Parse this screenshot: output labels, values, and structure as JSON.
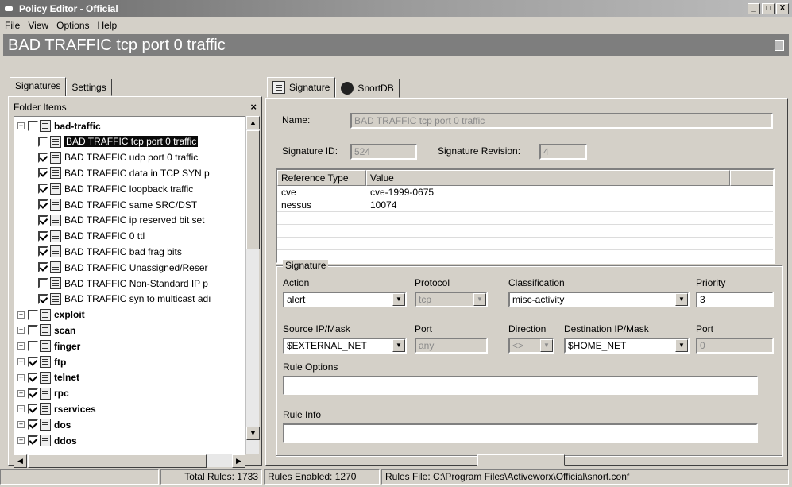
{
  "window": {
    "title": "Policy Editor - Official",
    "buttons": [
      "_",
      "□",
      "X"
    ]
  },
  "menu": [
    "File",
    "View",
    "Options",
    "Help"
  ],
  "policy_title": "BAD TRAFFIC tcp port 0 traffic",
  "left": {
    "tabs": [
      "Signatures",
      "Settings"
    ],
    "folder_header": "Folder Items",
    "close_glyph": "×",
    "tree": [
      {
        "type": "folder",
        "label": "bad-traffic",
        "checked": false,
        "expander": "−"
      },
      {
        "type": "rule",
        "label": "BAD TRAFFIC tcp port 0 traffic",
        "checked": false,
        "selected": true
      },
      {
        "type": "rule",
        "label": "BAD TRAFFIC udp port 0 traffic",
        "checked": true
      },
      {
        "type": "rule",
        "label": "BAD TRAFFIC data in TCP SYN p",
        "checked": true
      },
      {
        "type": "rule",
        "label": "BAD TRAFFIC loopback traffic",
        "checked": true
      },
      {
        "type": "rule",
        "label": "BAD TRAFFIC same SRC/DST",
        "checked": true
      },
      {
        "type": "rule",
        "label": "BAD TRAFFIC ip reserved bit set",
        "checked": true
      },
      {
        "type": "rule",
        "label": "BAD TRAFFIC 0 ttl",
        "checked": true
      },
      {
        "type": "rule",
        "label": "BAD TRAFFIC bad frag bits",
        "checked": true
      },
      {
        "type": "rule",
        "label": "BAD TRAFFIC Unassigned/Reser",
        "checked": true
      },
      {
        "type": "rule",
        "label": "BAD TRAFFIC Non-Standard IP p",
        "checked": false
      },
      {
        "type": "rule",
        "label": "BAD TRAFFIC syn to multicast adı",
        "checked": true
      },
      {
        "type": "folder",
        "label": "exploit",
        "checked": false,
        "expander": "+"
      },
      {
        "type": "folder",
        "label": "scan",
        "checked": false,
        "expander": "+"
      },
      {
        "type": "folder",
        "label": "finger",
        "checked": false,
        "expander": "+"
      },
      {
        "type": "folder",
        "label": "ftp",
        "checked": true,
        "expander": "+"
      },
      {
        "type": "folder",
        "label": "telnet",
        "checked": true,
        "expander": "+"
      },
      {
        "type": "folder",
        "label": "rpc",
        "checked": true,
        "expander": "+"
      },
      {
        "type": "folder",
        "label": "rservices",
        "checked": true,
        "expander": "+"
      },
      {
        "type": "folder",
        "label": "dos",
        "checked": true,
        "expander": "+"
      },
      {
        "type": "folder",
        "label": "ddos",
        "checked": true,
        "expander": "+"
      }
    ]
  },
  "right": {
    "tabs": [
      "Signature",
      "SnortDB"
    ],
    "name_label": "Name:",
    "name_value": "BAD TRAFFIC tcp port 0 traffic",
    "sig_id_label": "Signature ID:",
    "sig_id_value": "524",
    "sig_rev_label": "Signature Revision:",
    "sig_rev_value": "4",
    "ref_headers": [
      "Reference Type",
      "Value"
    ],
    "refs": [
      {
        "type": "cve",
        "value": "cve-1999-0675"
      },
      {
        "type": "nessus",
        "value": "10074"
      }
    ],
    "group_title": "Signature",
    "action_label": "Action",
    "action_value": "alert",
    "protocol_label": "Protocol",
    "protocol_value": "tcp",
    "classification_label": "Classification",
    "classification_value": "misc-activity",
    "priority_label": "Priority",
    "priority_value": "3",
    "src_label": "Source IP/Mask",
    "src_value": "$EXTERNAL_NET",
    "src_port_label": "Port",
    "src_port_value": "any",
    "direction_label": "Direction",
    "direction_value": "<>",
    "dst_label": "Destination IP/Mask",
    "dst_value": "$HOME_NET",
    "dst_port_label": "Port",
    "dst_port_value": "0",
    "rule_options_label": "Rule Options",
    "rule_info_label": "Rule Info"
  },
  "status": {
    "total_rules": "Total Rules: 1733",
    "rules_enabled": "Rules Enabled: 1270",
    "rules_file": "Rules File: C:\\Program Files\\Activeworx\\Official\\snort.conf"
  }
}
